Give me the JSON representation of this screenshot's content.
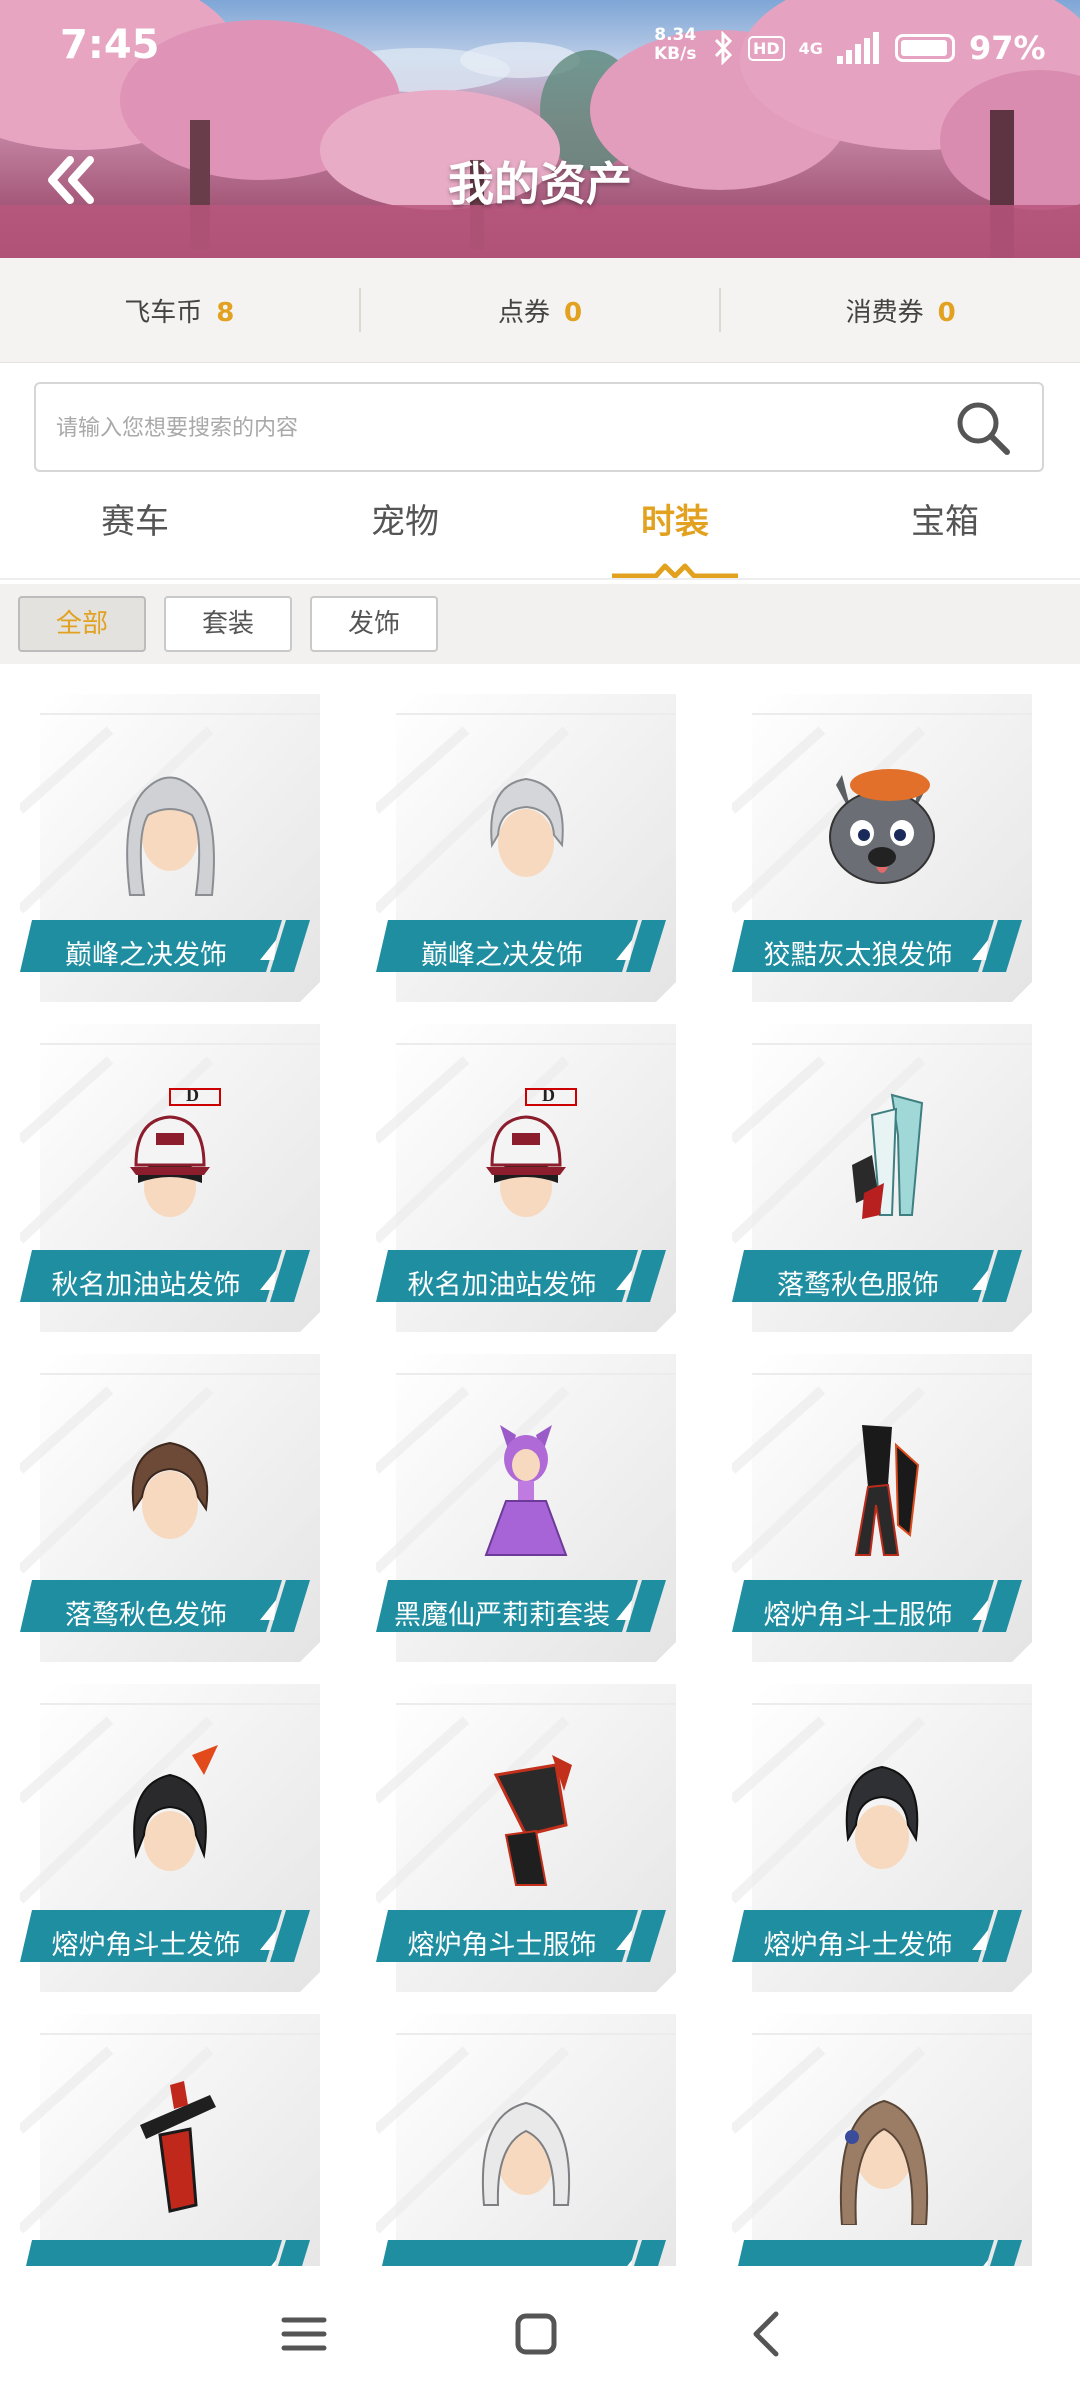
{
  "status_bar": {
    "time": "7:45",
    "net_speed_value": "8.34",
    "net_speed_unit": "KB/s",
    "hd_badge": "HD",
    "network_type": "4G",
    "battery_level": 0.97,
    "battery_percent": "97%"
  },
  "header": {
    "title": "我的资产",
    "back_icon": "double-chevron-left-icon"
  },
  "currencies": [
    {
      "label": "飞车币",
      "value": "8"
    },
    {
      "label": "点券",
      "value": "0"
    },
    {
      "label": "消费券",
      "value": "0"
    }
  ],
  "search": {
    "placeholder": "请输入您想要搜索的内容",
    "icon": "search-icon"
  },
  "tabs": [
    {
      "label": "赛车",
      "active": false
    },
    {
      "label": "宠物",
      "active": false
    },
    {
      "label": "时装",
      "active": true
    },
    {
      "label": "宝箱",
      "active": false
    }
  ],
  "filters": [
    {
      "label": "全部",
      "active": true
    },
    {
      "label": "套装",
      "active": false
    },
    {
      "label": "发饰",
      "active": false
    }
  ],
  "accent_color": "#e2a11f",
  "label_color": "#1f8ea1",
  "items": [
    {
      "label": "巅峰之决发饰",
      "art": "hair-silver-long"
    },
    {
      "label": "巅峰之决发饰",
      "art": "hair-silver-short"
    },
    {
      "label": "狡黠灰太狼发饰",
      "art": "wolf-hat"
    },
    {
      "label": "秋名加油站发饰",
      "art": "cap-initial-d"
    },
    {
      "label": "秋名加油站发饰",
      "art": "cap-initial-d"
    },
    {
      "label": "落鹜秋色服饰",
      "art": "outfit-teal"
    },
    {
      "label": "落鹜秋色发饰",
      "art": "hair-brown"
    },
    {
      "label": "黑魔仙严莉莉套装",
      "art": "suit-purple-girl"
    },
    {
      "label": "熔炉角斗士服饰",
      "art": "outfit-black-red"
    },
    {
      "label": "熔炉角斗士发饰",
      "art": "hair-black-red"
    },
    {
      "label": "熔炉角斗士服饰",
      "art": "outfit-armor"
    },
    {
      "label": "熔炉角斗士发饰",
      "art": "hair-black"
    },
    {
      "label": "",
      "art": "outfit-gun"
    },
    {
      "label": "",
      "art": "hair-white"
    },
    {
      "label": "",
      "art": "hair-long-brown"
    }
  ],
  "nav": {
    "menu_icon": "menu-icon",
    "home_icon": "home-square-icon",
    "back_icon": "back-chevron-icon"
  }
}
